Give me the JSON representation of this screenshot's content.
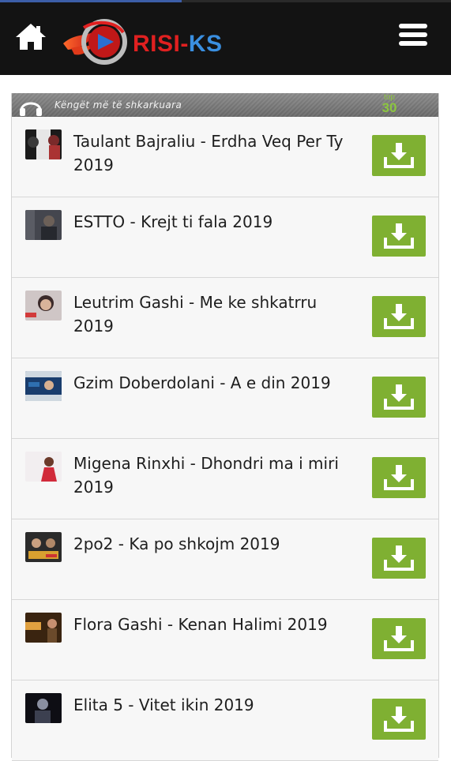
{
  "header": {
    "logo_text_a": "RISI-",
    "logo_text_b": "KS",
    "home_icon": "home-icon",
    "menu_icon": "hamburger-menu-icon"
  },
  "section": {
    "title": "Këngët më të shkarkuara",
    "badge_top": "top",
    "badge_num": "30"
  },
  "songs": [
    {
      "title": "Taulant Bajraliu - Erdha Veq Per Ty 2019",
      "thumb_colors": [
        "#1b1b1b",
        "#e0e0e0",
        "#a33"
      ]
    },
    {
      "title": "ESTTO - Krejt ti fala 2019",
      "thumb_colors": [
        "#4a4a52",
        "#26282e",
        "#7b7e88"
      ]
    },
    {
      "title": "Leutrim Gashi - Me ke shkatrru 2019",
      "thumb_colors": [
        "#c9c3c3",
        "#3b2a2a",
        "#d23a3a"
      ]
    },
    {
      "title": "Gzim Doberdolani - A e din 2019",
      "thumb_colors": [
        "#1a3d6d",
        "#2f6fb0",
        "#cfd8e0"
      ]
    },
    {
      "title": "Migena Rinxhi - Dhondri ma i miri 2019",
      "thumb_colors": [
        "#f2eef0",
        "#d12a3a",
        "#b88"
      ]
    },
    {
      "title": "2po2 - Ka po shkojm 2019",
      "thumb_colors": [
        "#2b2b2b",
        "#d8a030",
        "#c33"
      ]
    },
    {
      "title": "Flora Gashi - Kenan Halimi 2019",
      "thumb_colors": [
        "#3a2410",
        "#e0a040",
        "#6b4a2b"
      ]
    },
    {
      "title": "Elita 5 - Vitet ikin 2019",
      "thumb_colors": [
        "#0e0e14",
        "#3c4050",
        "#8a8fa0"
      ]
    }
  ],
  "colors": {
    "download_green": "#7fb032",
    "header_bg": "#131313",
    "logo_red": "#e02020",
    "logo_blue": "#3a8fe0"
  },
  "download_icon": "download-icon"
}
